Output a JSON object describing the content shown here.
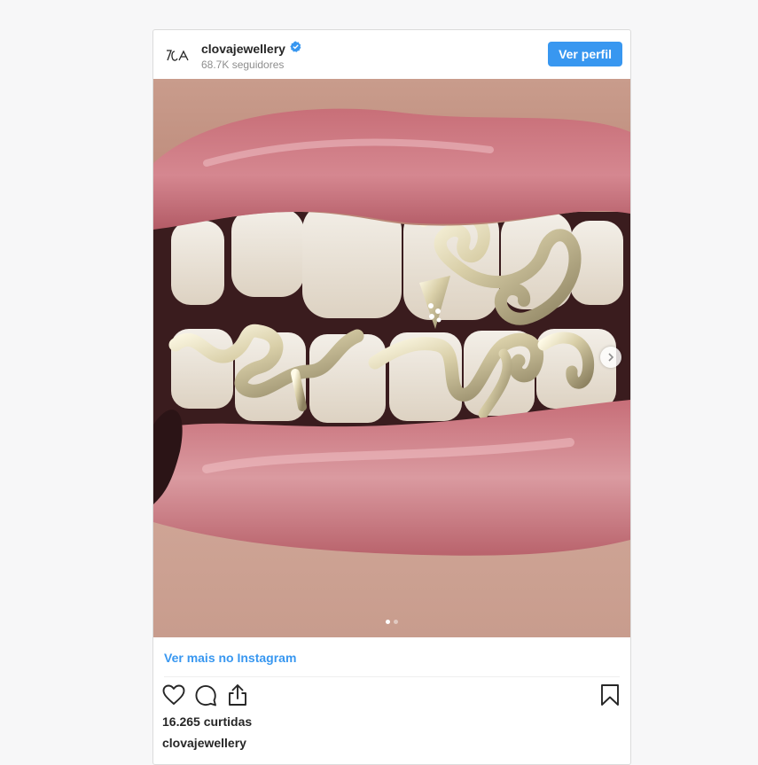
{
  "post": {
    "header": {
      "username": "clovajewellery",
      "followers": "68.7K seguidores",
      "view_profile_label": "Ver perfil",
      "avatar_icon": "clova-logo-icon",
      "verified_icon": "verified-badge-icon",
      "logo_text": "ΊCA"
    },
    "media": {
      "description_icon": "photo-mouth-grillz",
      "next_icon": "chevron-right-icon",
      "slides_total": 2,
      "slide_current": 1
    },
    "more_link_label": "Ver mais no Instagram",
    "actions": {
      "like_icon": "heart-icon",
      "comment_icon": "comment-icon",
      "share_icon": "share-icon",
      "save_icon": "bookmark-icon"
    },
    "likes_label": "16.265 curtidas",
    "caption_username": "clovajewellery"
  },
  "colors": {
    "accent": "#3897f0",
    "text": "#262626",
    "muted": "#8e8e8e",
    "border": "#dbdbdb"
  }
}
